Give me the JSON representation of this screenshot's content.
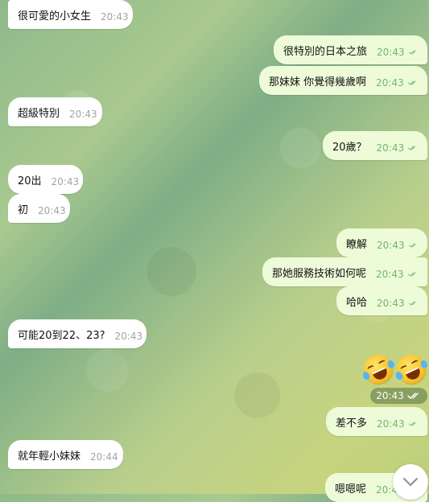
{
  "messages": [
    {
      "text": "很可愛的小女生",
      "time": "20:43",
      "dir": "in"
    },
    {
      "text": "很特別的日本之旅",
      "time": "20:43",
      "dir": "out"
    },
    {
      "text": "那妹妹 你覺得幾歲啊",
      "time": "20:43",
      "dir": "out"
    },
    {
      "text": "超級特別",
      "time": "20:43",
      "dir": "in"
    },
    {
      "text": "20歲？",
      "time": "20:43",
      "dir": "out"
    },
    {
      "text": "20出",
      "time": "20:43",
      "dir": "in"
    },
    {
      "text": "初",
      "time": "20:43",
      "dir": "in"
    },
    {
      "text": "瞭解",
      "time": "20:43",
      "dir": "out"
    },
    {
      "text": "那她服務技術如何呢",
      "time": "20:43",
      "dir": "out"
    },
    {
      "text": "哈哈",
      "time": "20:43",
      "dir": "out"
    },
    {
      "text": "可能20到22、23?",
      "time": "20:43",
      "dir": "in"
    },
    {
      "text": "差不多",
      "time": "20:43",
      "dir": "out"
    },
    {
      "text": "就年輕小妹妹",
      "time": "20:44",
      "dir": "in"
    },
    {
      "text": "嗯嗯呢",
      "time": "20:44",
      "dir": "out"
    }
  ],
  "emoji_message": {
    "emojis": [
      "rolling-on-floor-laughing",
      "rolling-on-floor-laughing"
    ],
    "time": "20:43"
  },
  "colors": {
    "incoming_bubble": "#ffffff",
    "outgoing_bubble": "#eefbd9",
    "outgoing_time": "#6fb86a",
    "incoming_time": "#a3a3a3"
  }
}
